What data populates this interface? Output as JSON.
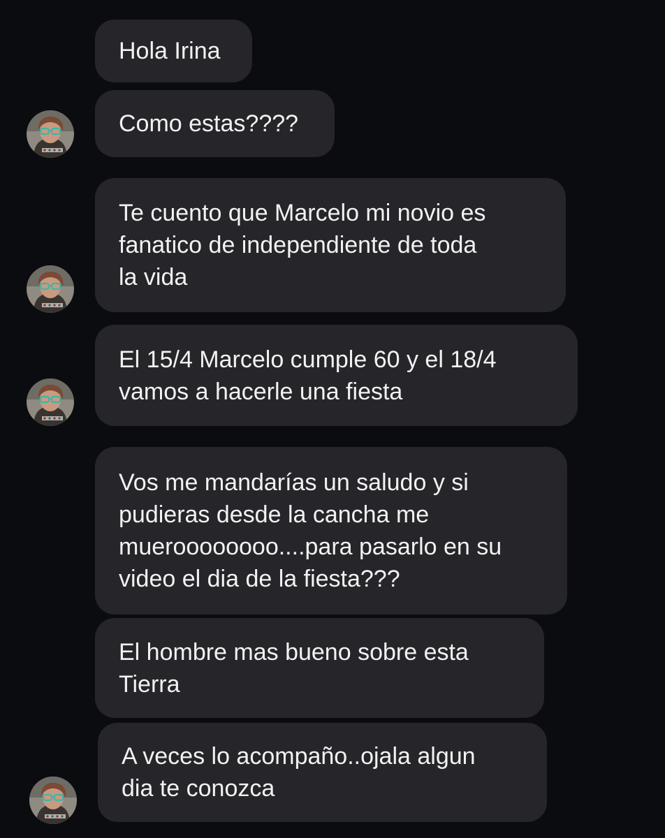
{
  "conversation": {
    "messages": [
      {
        "text": "Hola Irina"
      },
      {
        "text": "Como estas????"
      },
      {
        "text": "Te cuento que Marcelo mi novio es\nfanatico de independiente de toda\nla vida"
      },
      {
        "text": "El 15/4 Marcelo cumple 60 y el 18/4\nvamos a hacerle una fiesta"
      },
      {
        "text": "Vos me mandarías un saludo y si\npudieras desde la cancha me\nmueroooooooo....para pasarlo en su\nvideo el dia de la fiesta???"
      },
      {
        "text": "El hombre mas bueno sobre esta\nTierra"
      },
      {
        "text": "A veces lo acompaño..ojala algun\ndia te conozca"
      }
    ]
  },
  "colors": {
    "background": "#0b0c10",
    "bubble": "#25252a",
    "text": "#f2f2f2"
  },
  "icons": {
    "sender_avatar": "profile-photo-avatar"
  }
}
